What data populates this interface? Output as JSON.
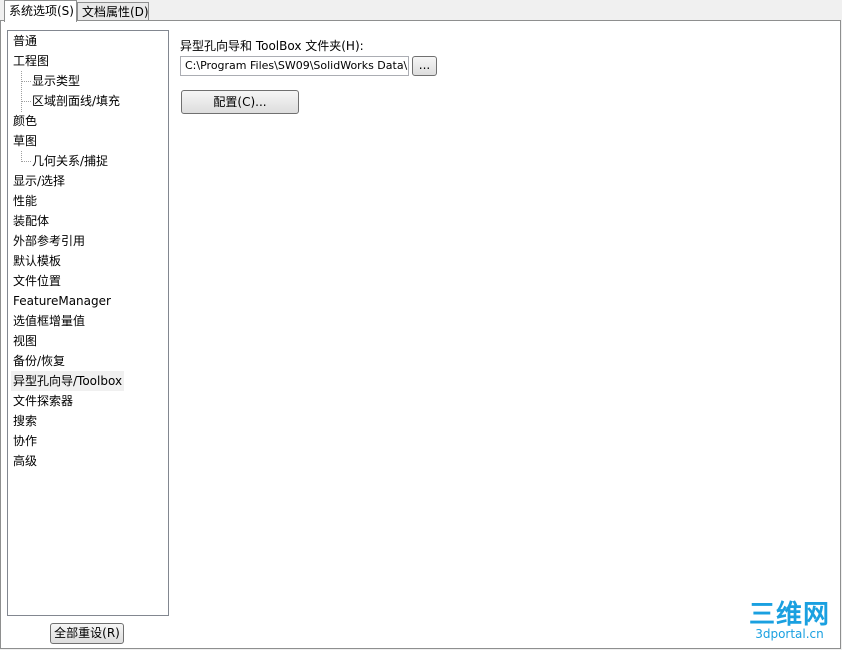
{
  "tabs": [
    {
      "label": "系统选项(S)"
    },
    {
      "label": "文档属性(D)"
    }
  ],
  "tree": {
    "items": [
      {
        "label": "普通"
      },
      {
        "label": "工程图"
      },
      {
        "label": "显示类型"
      },
      {
        "label": "区域剖面线/填充"
      },
      {
        "label": "颜色"
      },
      {
        "label": "草图"
      },
      {
        "label": "几何关系/捕捉"
      },
      {
        "label": "显示/选择"
      },
      {
        "label": "性能"
      },
      {
        "label": "装配体"
      },
      {
        "label": "外部参考引用"
      },
      {
        "label": "默认模板"
      },
      {
        "label": "文件位置"
      },
      {
        "label": "FeatureManager"
      },
      {
        "label": "选值框增量值"
      },
      {
        "label": "视图"
      },
      {
        "label": "备份/恢复"
      },
      {
        "label": "异型孔向导/Toolbox"
      },
      {
        "label": "文件探索器"
      },
      {
        "label": "搜索"
      },
      {
        "label": "协作"
      },
      {
        "label": "高级"
      }
    ],
    "selected": "异型孔向导/Toolbox"
  },
  "main": {
    "folder_label": "异型孔向导和 ToolBox 文件夹(H):",
    "folder_value": "C:\\Program Files\\SW09\\SolidWorks Data\\",
    "browse_label": "...",
    "configure_label": "配置(C)..."
  },
  "footer": {
    "reset_label": "全部重设(R)"
  },
  "watermark": {
    "main": "三维网",
    "sub": "3dportal.cn"
  }
}
